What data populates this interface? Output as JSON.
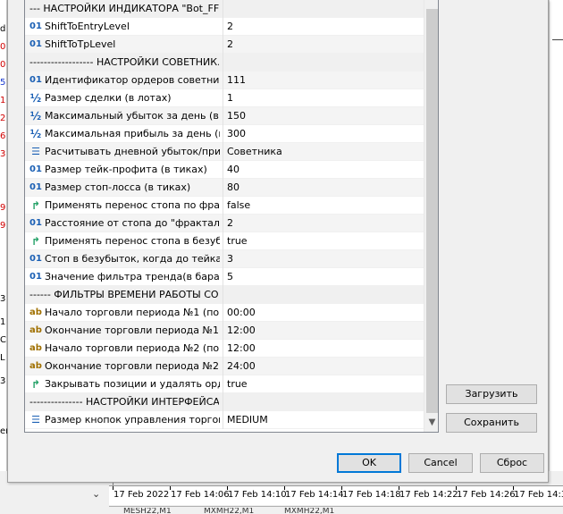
{
  "background": {
    "left_markers": [
      {
        "text": "d",
        "color": "#000000"
      },
      {
        "text": "0",
        "color": "#d00000"
      },
      {
        "text": "0",
        "color": "#d00000"
      },
      {
        "text": "5",
        "color": "#1a3ad0"
      },
      {
        "text": "1",
        "color": "#d00000"
      },
      {
        "text": "2",
        "color": "#d00000"
      },
      {
        "text": "6",
        "color": "#d00000"
      },
      {
        "text": "3",
        "color": "#d00000"
      },
      {
        "text": "9",
        "color": "#d00000"
      },
      {
        "text": "9",
        "color": "#d00000"
      },
      {
        "text": "3",
        "color": "#000000"
      },
      {
        "text": "1",
        "color": "#000000"
      },
      {
        "text": "C",
        "color": "#000000"
      },
      {
        "text": "L",
        "color": "#000000"
      },
      {
        "text": "3",
        "color": "#000000"
      },
      {
        "text": "er",
        "color": "#000000"
      }
    ],
    "time_axis": [
      "17 Feb 2022",
      "17 Feb 14:06",
      "17 Feb 14:10",
      "17 Feb 14:14",
      "17 Feb 14:18",
      "17 Feb 14:22",
      "17 Feb 14:26",
      "17 Feb 14:30"
    ],
    "chart_tabs": [
      "MESH22,M1",
      "MXMH22,M1",
      "MXMH22,M1"
    ]
  },
  "params": [
    {
      "type": "header",
      "name": "---  НАСТРОЙКИ ИНДИКАТОРА \"Bot_FF_...",
      "value": ""
    },
    {
      "type": "int",
      "icon": "01",
      "name": "ShiftToEntryLevel",
      "value": "2"
    },
    {
      "type": "int",
      "icon": "01",
      "name": "ShiftToTpLevel",
      "value": "2"
    },
    {
      "type": "header",
      "name": "------------------  НАСТРОЙКИ СОВЕТНИК...",
      "value": ""
    },
    {
      "type": "int",
      "icon": "01",
      "name": "Идентификатор ордеров советника...",
      "value": "111"
    },
    {
      "type": "double",
      "icon": "½",
      "name": "Размер сделки (в лотах)",
      "value": "1"
    },
    {
      "type": "double",
      "icon": "½",
      "name": "Максимальный убыток за день (в е...",
      "value": "150"
    },
    {
      "type": "double",
      "icon": "½",
      "name": "Максимальная прибыль за день (в е...",
      "value": "300"
    },
    {
      "type": "enum",
      "icon": "☰",
      "name": "Расчитывать дневной убыток/приб...",
      "value": "Советника"
    },
    {
      "type": "int",
      "icon": "01",
      "name": "Размер тейк-профита (в тиках)",
      "value": "40"
    },
    {
      "type": "int",
      "icon": "01",
      "name": "Размер стоп-лосса (в тиках)",
      "value": "80"
    },
    {
      "type": "bool",
      "icon": "↱",
      "name": "Применять перенос стопа по фракт...",
      "value": "false"
    },
    {
      "type": "int",
      "icon": "01",
      "name": "Расстояние от стопа до \"фрактальн...",
      "value": "2"
    },
    {
      "type": "bool",
      "icon": "↱",
      "name": "Применять перенос стопа в безубы...",
      "value": "true"
    },
    {
      "type": "int",
      "icon": "01",
      "name": "Стоп в безубыток, когда до тейка ...",
      "value": "3"
    },
    {
      "type": "int",
      "icon": "01",
      "name": "Значение фильтра тренда(в барах)",
      "value": "5"
    },
    {
      "type": "header",
      "name": "------  ФИЛЬТРЫ ВРЕМЕНИ РАБОТЫ СОВ...",
      "value": ""
    },
    {
      "type": "string",
      "icon": "ab",
      "name": "Начало торговли периода №1 (по в...",
      "value": "00:00"
    },
    {
      "type": "string",
      "icon": "ab",
      "name": "Окончание торговли периода №1 (...",
      "value": "12:00"
    },
    {
      "type": "string",
      "icon": "ab",
      "name": "Начало торговли периода №2 (по в...",
      "value": "12:00"
    },
    {
      "type": "string",
      "icon": "ab",
      "name": "Окончание торговли периода №2 (ор...",
      "value": "24:00"
    },
    {
      "type": "bool",
      "icon": "↱",
      "name": "Закрывать позиции и удалять орде...",
      "value": "true"
    },
    {
      "type": "header",
      "name": "---------------  НАСТРОЙКИ ИНТЕРФЕЙСА...",
      "value": ""
    },
    {
      "type": "enum",
      "icon": "☰",
      "name": "Размер кнопок управления торговл...",
      "value": "MEDIUM"
    }
  ],
  "buttons": {
    "load": "Загрузить",
    "save": "Сохранить",
    "ok": "OK",
    "cancel": "Cancel",
    "reset": "Сброс"
  }
}
